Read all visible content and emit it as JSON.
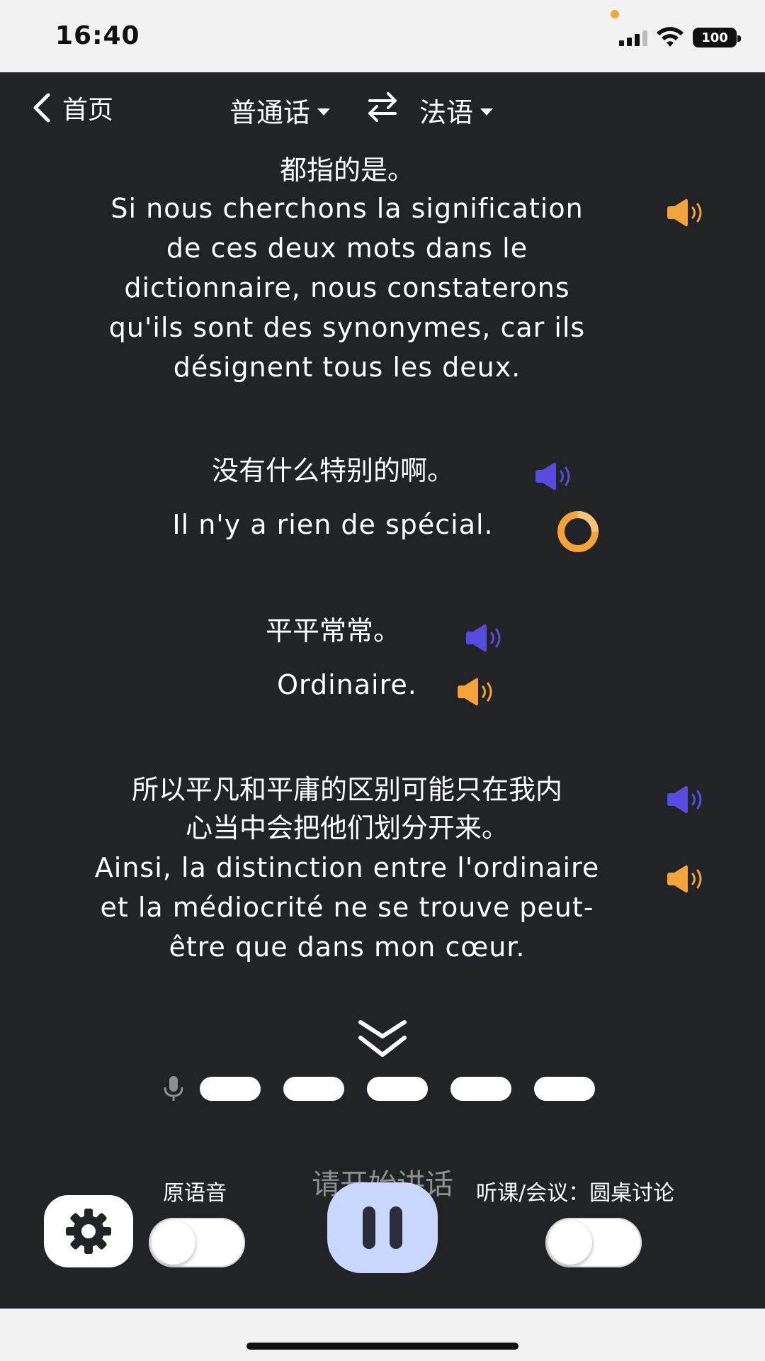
{
  "status_bar": {
    "time": "16:40",
    "battery": "100"
  },
  "header": {
    "back_label": "首页",
    "source_lang": "普通话",
    "target_lang": "法语"
  },
  "transcript": {
    "entry1": {
      "zh_tail": "都指的是。",
      "fr_lines": [
        "Si nous cherchons la signification",
        "de ces deux mots dans le",
        "dictionnaire, nous constaterons",
        "qu'ils sont des synonymes, car ils",
        "désignent tous les deux."
      ]
    },
    "entry2": {
      "zh": "没有什么特别的啊。",
      "fr": "Il n'y a rien de spécial."
    },
    "entry3": {
      "zh": "平平常常。",
      "fr": "Ordinaire."
    },
    "entry4": {
      "zh_lines": [
        "所以平凡和平庸的区别可能只在我内",
        "心当中会把他们划分开来。"
      ],
      "fr_lines": [
        "Ainsi, la distinction entre l'ordinaire",
        "et la médiocrité ne se trouve peut-",
        "être que dans mon cœur."
      ]
    }
  },
  "voice": {
    "prompt": "请开始讲话"
  },
  "controls": {
    "original_voice_label": "原语音",
    "mode_label": "听课/会议：圆桌讨论"
  },
  "colors": {
    "background": "#222326",
    "speaker_orange": "#f2a33a",
    "speaker_purple": "#5a4be0",
    "pause_button": "#c9d6ff"
  }
}
